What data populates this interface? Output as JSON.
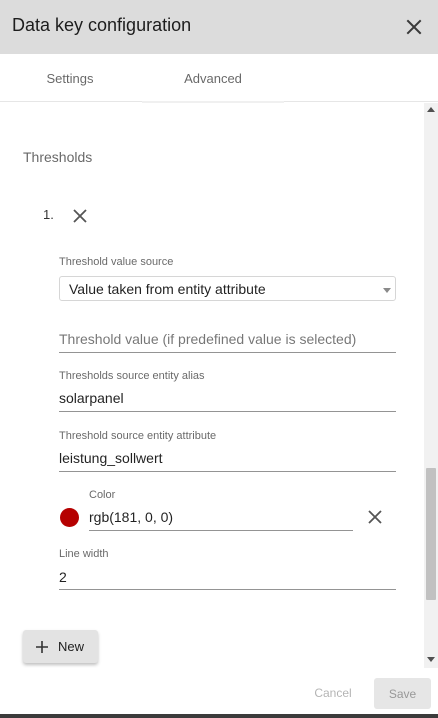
{
  "dialog": {
    "title": "Data key configuration",
    "close_icon": "close-icon"
  },
  "tabs": [
    {
      "label": "Settings",
      "active": false
    },
    {
      "label": "Advanced",
      "active": true
    }
  ],
  "thresholds": {
    "section_title": "Thresholds",
    "items": [
      {
        "index": "1.",
        "value_source": {
          "label": "Threshold value source",
          "selected": "Value taken from entity attribute"
        },
        "threshold_value": {
          "placeholder": "Threshold value (if predefined value is selected)",
          "value": ""
        },
        "entity_alias": {
          "label": "Thresholds source entity alias",
          "value": "solarpanel"
        },
        "entity_attribute": {
          "label": "Threshold source entity attribute",
          "value": "leistung_sollwert"
        },
        "color": {
          "label": "Color",
          "value": "rgb(181, 0, 0)",
          "swatch": "#b50000"
        },
        "line_width": {
          "label": "Line width",
          "value": "2"
        }
      }
    ],
    "new_button_label": "New"
  },
  "actions": {
    "cancel_label": "Cancel",
    "save_label": "Save"
  }
}
